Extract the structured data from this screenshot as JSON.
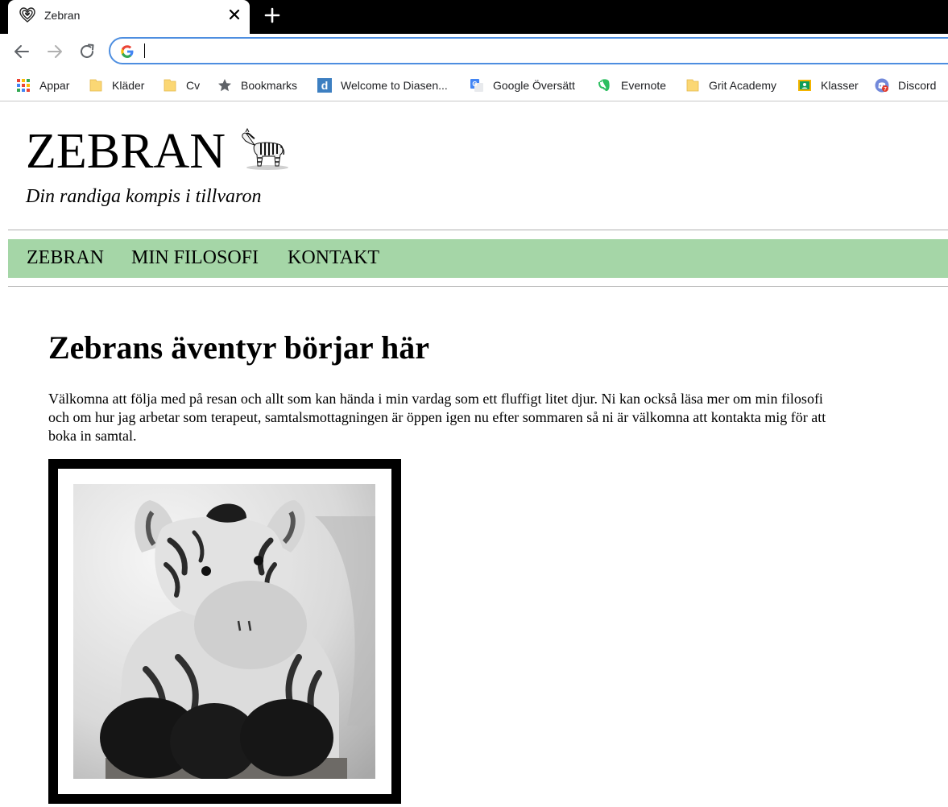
{
  "browser": {
    "tab_title": "Zebran",
    "address_value": "",
    "bookmarks": [
      {
        "label": "Appar",
        "icon": "apps-grid-icon"
      },
      {
        "label": "Kläder",
        "icon": "folder-icon"
      },
      {
        "label": "Cv",
        "icon": "folder-icon"
      },
      {
        "label": "Bookmarks",
        "icon": "star-icon"
      },
      {
        "label": "Welcome to Diasen...",
        "icon": "diasen-icon"
      },
      {
        "label": "Google Översätt",
        "icon": "google-translate-icon"
      },
      {
        "label": "Evernote",
        "icon": "evernote-icon"
      },
      {
        "label": "Grit Academy",
        "icon": "folder-icon"
      },
      {
        "label": "Klasser",
        "icon": "classroom-icon"
      },
      {
        "label": "Discord",
        "icon": "discord-icon"
      }
    ]
  },
  "site": {
    "title": "ZEBRAN",
    "tagline": "Din randiga kompis i tillvaron",
    "nav": [
      "ZEBRAN",
      "MIN FILOSOFI",
      "KONTAKT"
    ],
    "heading": "Zebrans äventyr börjar här",
    "intro": "Välkomna att följa med på resan och allt som kan hända i min vardag som ett fluffigt litet djur. Ni kan också läsa mer om min filosofi och om hur jag arbetar som terapeut, samtalsmottagningen är öppen igen nu efter sommaren så ni är välkomna att kontakta mig för att boka in samtal."
  },
  "colors": {
    "nav_background": "#a5d6a7",
    "omnibox_border": "#4d8ee0",
    "tabstrip": "#000000",
    "photo_frame": "#000000"
  }
}
